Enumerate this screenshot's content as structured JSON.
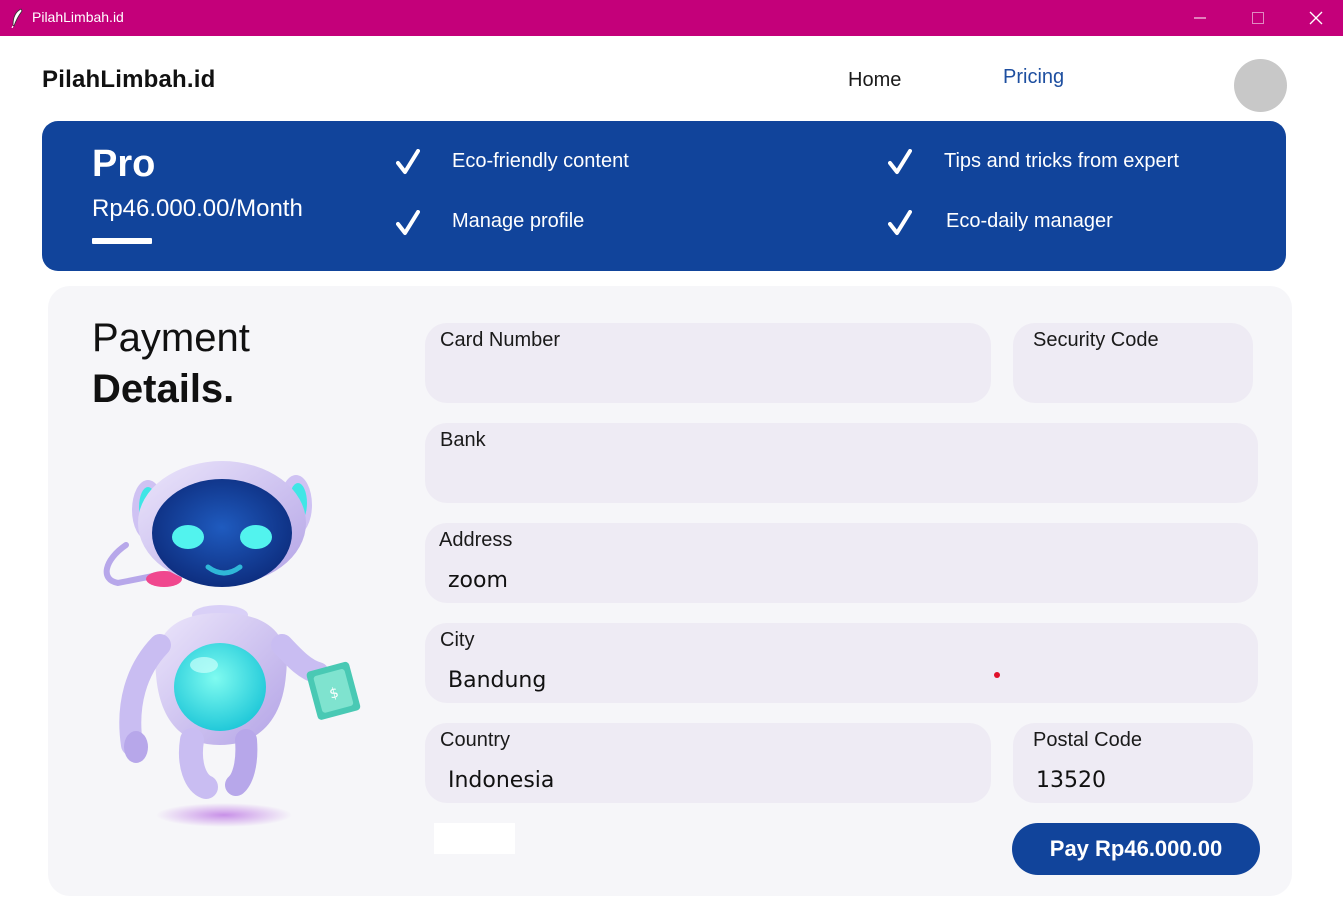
{
  "window": {
    "title": "PilahLimbah.id"
  },
  "nav": {
    "brand": "PilahLimbah.id",
    "home": "Home",
    "pricing": "Pricing"
  },
  "plan": {
    "name": "Pro",
    "price": "Rp46.000.00/Month",
    "features": [
      "Eco-friendly content",
      "Tips and tricks from expert",
      "Manage profile",
      "Eco-daily manager"
    ]
  },
  "payment": {
    "title_line1": "Payment",
    "title_line2": "Details.",
    "fields": {
      "card_number": {
        "label": "Card Number",
        "value": ""
      },
      "security_code": {
        "label": "Security Code",
        "value": ""
      },
      "bank": {
        "label": "Bank",
        "value": ""
      },
      "address": {
        "label": "Address",
        "value": "zoom"
      },
      "city": {
        "label": "City",
        "value": "Bandung"
      },
      "country": {
        "label": "Country",
        "value": "Indonesia"
      },
      "postal_code": {
        "label": "Postal Code",
        "value": "13520"
      }
    },
    "pay_button": "Pay Rp46.000.00"
  },
  "colors": {
    "titlebar": "#c4007a",
    "primary": "#11449b",
    "field_bg": "#eeebf4",
    "card_bg": "#f6f6f9",
    "link": "#1e4fa0"
  },
  "icons": [
    "feather-icon",
    "minimize-icon",
    "maximize-icon",
    "close-icon",
    "check-icon",
    "robot-mascot"
  ]
}
